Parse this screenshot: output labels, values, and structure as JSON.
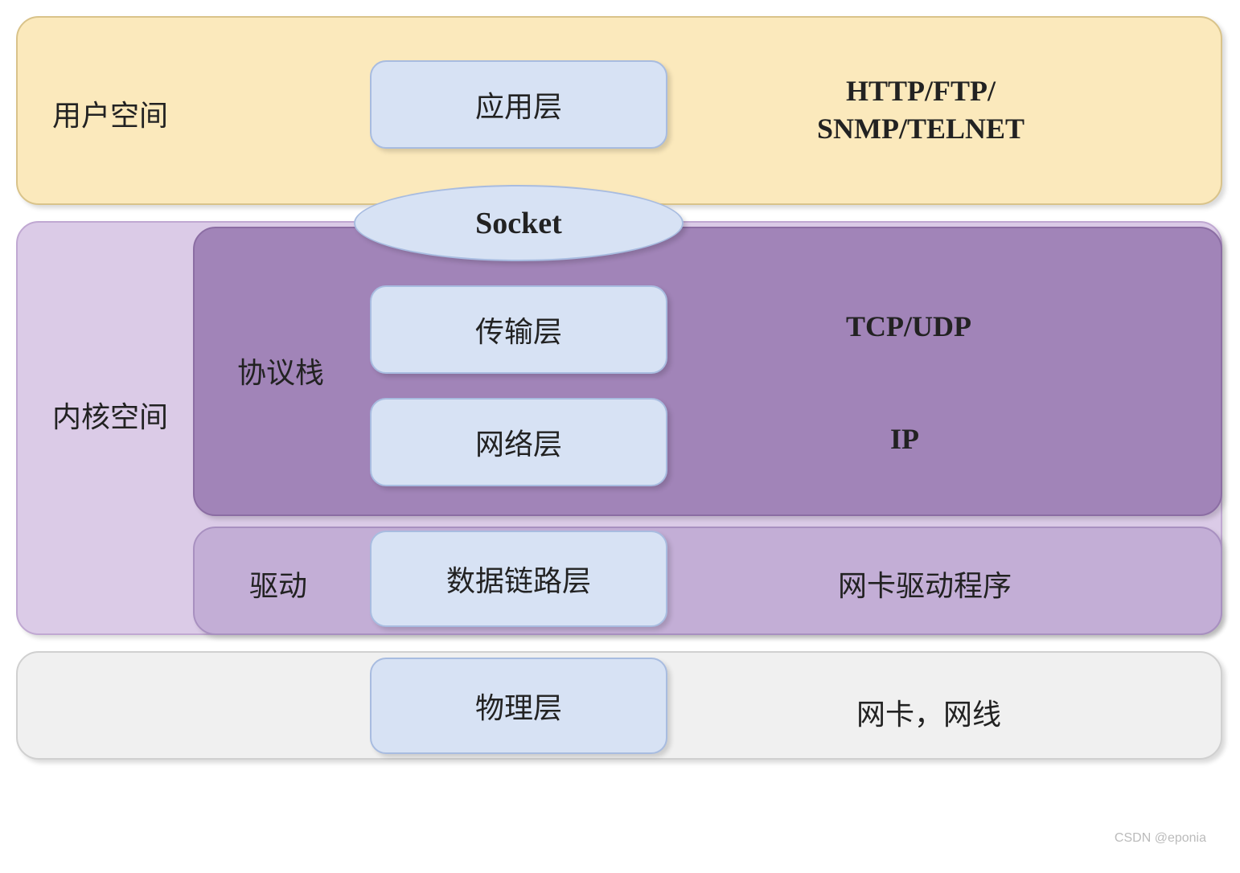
{
  "spaces": {
    "user_space": "用户空间",
    "kernel_space": "内核空间"
  },
  "sections": {
    "protocol_stack": "协议栈",
    "driver": "驱动"
  },
  "layers": {
    "application": "应用层",
    "transport": "传输层",
    "network": "网络层",
    "datalink": "数据链路层",
    "physical": "物理层"
  },
  "socket": "Socket",
  "protocols": {
    "application": "HTTP/FTP/\nSNMP/TELNET",
    "transport": "TCP/UDP",
    "network": "IP",
    "datalink": "网卡驱动程序",
    "physical": "网卡，网线"
  },
  "watermark": "CSDN @eponia"
}
